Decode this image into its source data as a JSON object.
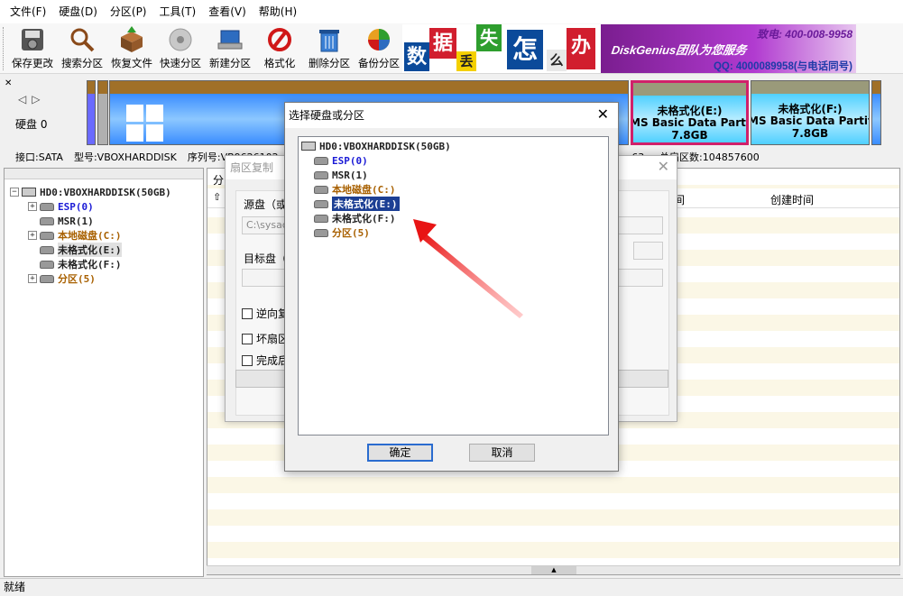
{
  "menu": [
    "文件(F)",
    "硬盘(D)",
    "分区(P)",
    "工具(T)",
    "查看(V)",
    "帮助(H)"
  ],
  "toolbar": {
    "save": "保存更改",
    "search": "搜索分区",
    "recover": "恢复文件",
    "quick": "快速分区",
    "newpart": "新建分区",
    "format": "格式化",
    "delete": "删除分区",
    "backup": "备份分区"
  },
  "ad": {
    "chars": [
      "数",
      "据",
      "丢",
      "失",
      "怎",
      "么",
      "办"
    ],
    "brand": "DiskGenius团队为您服务",
    "phone": "致电: 400-008-9958",
    "qq": "QQ: 4000089958(与电话同号)"
  },
  "diskmap": {
    "disk_label": "硬盘 0",
    "partitions": [
      {
        "name": "未格式化(E:)",
        "fs": "MS Basic Data Partition",
        "size": "7.8GB",
        "selected": true
      },
      {
        "name": "未格式化(F:)",
        "fs": "MS Basic Data Partition",
        "size": "7.8GB",
        "selected": false
      }
    ]
  },
  "info": {
    "iface": "接口:SATA",
    "model": "型号:VBOXHARDDISK",
    "serial": "序列号:VB9626102 ...",
    "sectors": "总扇区数:104857600",
    "heads": "...:63"
  },
  "tree": {
    "disk": "HD0:VBOXHARDDISK(50GB)",
    "items": [
      {
        "label": "ESP(0)",
        "color": "#1a1ad6"
      },
      {
        "label": "MSR(1)",
        "color": "#222222"
      },
      {
        "label": "本地磁盘(C:)",
        "color": "#a86000"
      },
      {
        "label": "未格式化(E:)",
        "color": "#222222"
      },
      {
        "label": "未格式化(F:)",
        "color": "#222222"
      },
      {
        "label": "分区(5)",
        "color": "#a86000"
      }
    ]
  },
  "rightpane": {
    "tab": "分",
    "col_modified": "间",
    "col_created": "创建时间"
  },
  "bgdialog": {
    "title": "扇区复制",
    "source_label": "源盘（或",
    "source_value": "C:\\sysac",
    "target_label": "目标盘（",
    "chk_reverse": "逆向复",
    "chk_badsector": "坏扇区",
    "chk_done": "完成后"
  },
  "modal": {
    "title": "选择硬盘或分区",
    "ok": "确定",
    "cancel": "取消",
    "selected_item": "未格式化(E:)"
  },
  "status": "就绪"
}
